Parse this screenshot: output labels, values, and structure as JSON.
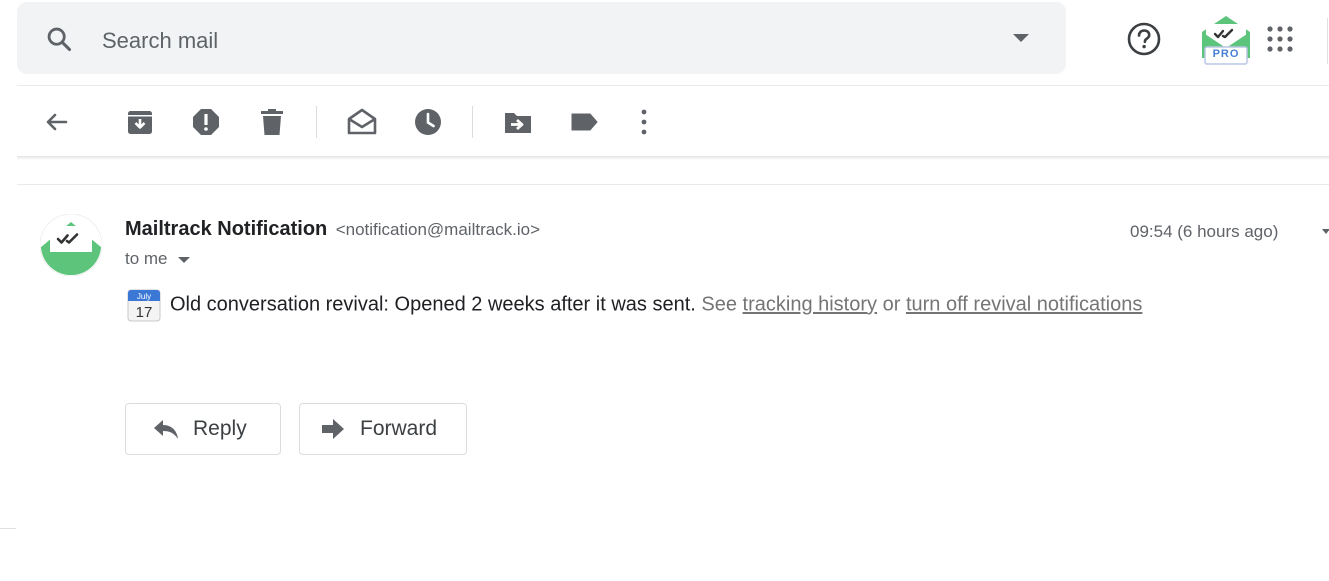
{
  "search": {
    "placeholder": "Search mail"
  },
  "header": {
    "pro_badge": "PRO"
  },
  "toolbar": {
    "items": [
      "back",
      "archive",
      "report-spam",
      "delete",
      "mark-unread",
      "snooze",
      "move-to",
      "labels",
      "more"
    ]
  },
  "message": {
    "sender_name": "Mailtrack Notification",
    "sender_email": "<notification@mailtrack.io>",
    "timestamp": "09:54 (6 hours ago)",
    "recipient": "to me",
    "calendar": {
      "month": "July",
      "day": "17"
    },
    "body_text": "Old conversation revival: Opened 2 weeks after it was sent.",
    "see_text": "See",
    "link_tracking": "tracking history",
    "or_text": "or",
    "link_turn_off": "turn off revival notifications"
  },
  "actions": {
    "reply_label": "Reply",
    "forward_label": "Forward"
  },
  "colors": {
    "search_bg": "#f1f3f4",
    "icon_gray": "#5f6368",
    "mailtrack_green": "#5cc47b",
    "pro_blue": "#4a7fd6"
  }
}
